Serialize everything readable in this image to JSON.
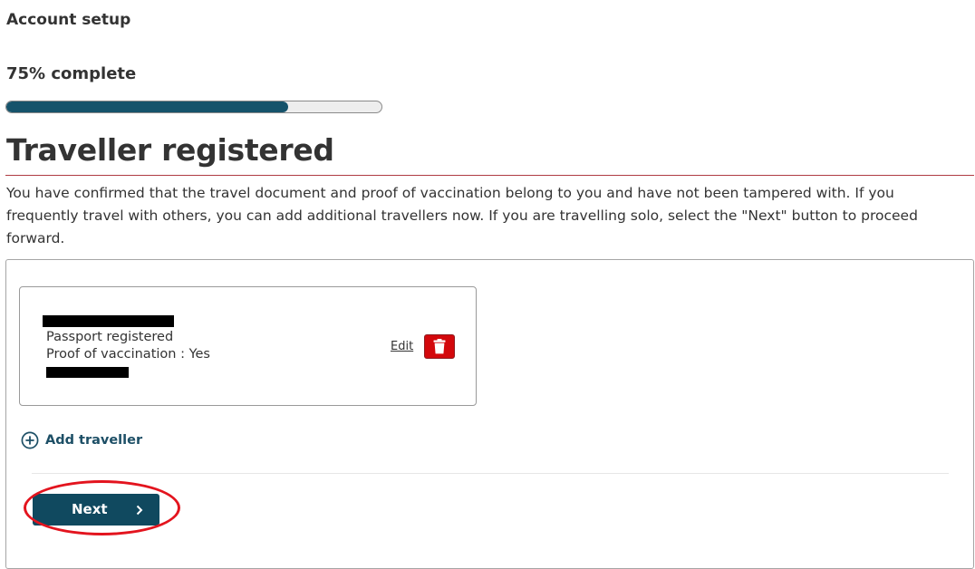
{
  "header": {
    "section_label": "Account setup",
    "progress_text": "75% complete",
    "progress_fraction": 0.75
  },
  "page": {
    "title": "Traveller registered",
    "intro": "You have confirmed that the travel document and proof of vaccination belong to you and have not been tampered with. If you frequently travel with others, you can add additional travellers now. If you are travelling solo, select the \"Next\" button to proceed forward."
  },
  "traveller": {
    "line1": "Passport registered",
    "line2": "Proof of vaccination : Yes",
    "edit_label": "Edit",
    "delete_icon": "trash-icon"
  },
  "actions": {
    "add_traveller_label": "Add traveller",
    "add_icon": "plus-circle-icon",
    "next_label": "Next",
    "next_icon": "chevron-right-icon"
  },
  "colors": {
    "progress_fill": "#16536b",
    "title_rule": "#af3c43",
    "delete_button": "#d3080c",
    "primary_button": "#10495f",
    "link": "#1d4f66",
    "highlight": "#e3141e"
  }
}
